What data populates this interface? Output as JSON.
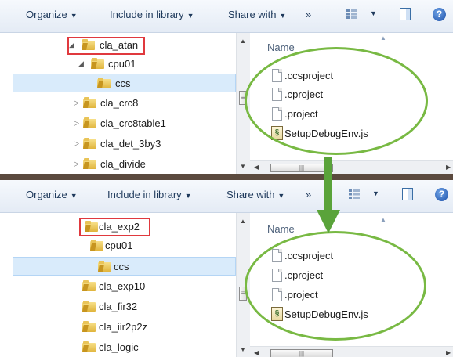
{
  "toolbar": {
    "organize": "Organize",
    "include_in_library": "Include in library",
    "share_with": "Share with",
    "more": "»"
  },
  "list_header": {
    "name": "Name"
  },
  "panel_before": {
    "tree": [
      {
        "label": "cla_atan",
        "state": "expanded",
        "highlighted": true
      },
      {
        "label": "cpu01",
        "state": "expanded"
      },
      {
        "label": "ccs",
        "state": "selected"
      },
      {
        "label": "cla_crc8",
        "state": "collapsed"
      },
      {
        "label": "cla_crc8table1",
        "state": "collapsed"
      },
      {
        "label": "cla_det_3by3",
        "state": "collapsed"
      },
      {
        "label": "cla_divide",
        "state": "collapsed"
      }
    ],
    "files": [
      {
        "name": ".ccsproject",
        "kind": "file"
      },
      {
        "name": ".cproject",
        "kind": "file"
      },
      {
        "name": ".project",
        "kind": "file"
      },
      {
        "name": "SetupDebugEnv.js",
        "kind": "script"
      }
    ]
  },
  "panel_after": {
    "tree": [
      {
        "label": "cla_exp2",
        "highlighted": true
      },
      {
        "label": "cpu01"
      },
      {
        "label": "ccs",
        "state": "selected"
      },
      {
        "label": "cla_exp10"
      },
      {
        "label": "cla_fir32"
      },
      {
        "label": "cla_iir2p2z"
      },
      {
        "label": "cla_logic"
      }
    ],
    "files": [
      {
        "name": ".ccsproject",
        "kind": "file"
      },
      {
        "name": ".cproject",
        "kind": "file"
      },
      {
        "name": ".project",
        "kind": "file"
      },
      {
        "name": "SetupDebugEnv.js",
        "kind": "script"
      }
    ]
  },
  "colors": {
    "highlight_box": "#e0393e",
    "ellipse": "#78b943",
    "arrow": "#5aa33a",
    "selection": "#d9ebfb"
  }
}
